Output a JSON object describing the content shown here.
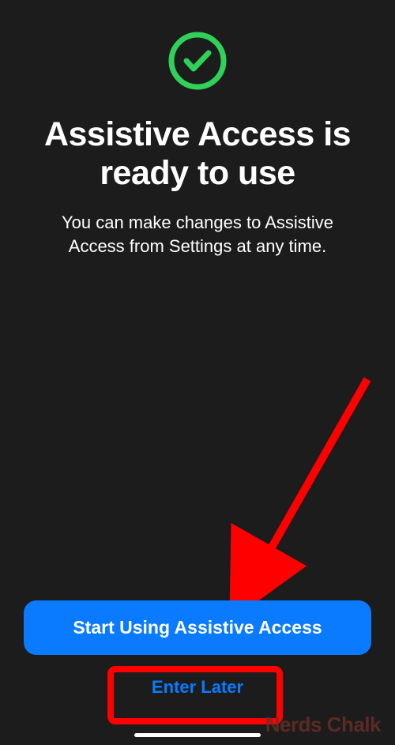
{
  "icon": {
    "name": "checkmark-circle",
    "stroke": "#30d158"
  },
  "title": "Assistive Access is ready to use",
  "subtitle": "You can make changes to Assistive Access from Settings at any time.",
  "buttons": {
    "primary": "Start Using Assistive Access",
    "secondary": "Enter Later"
  },
  "watermark": "Nerds Chalk",
  "colors": {
    "background": "#1c1c1c",
    "accent": "#0a7aff",
    "success": "#30d158",
    "annotation": "#ff0000"
  }
}
